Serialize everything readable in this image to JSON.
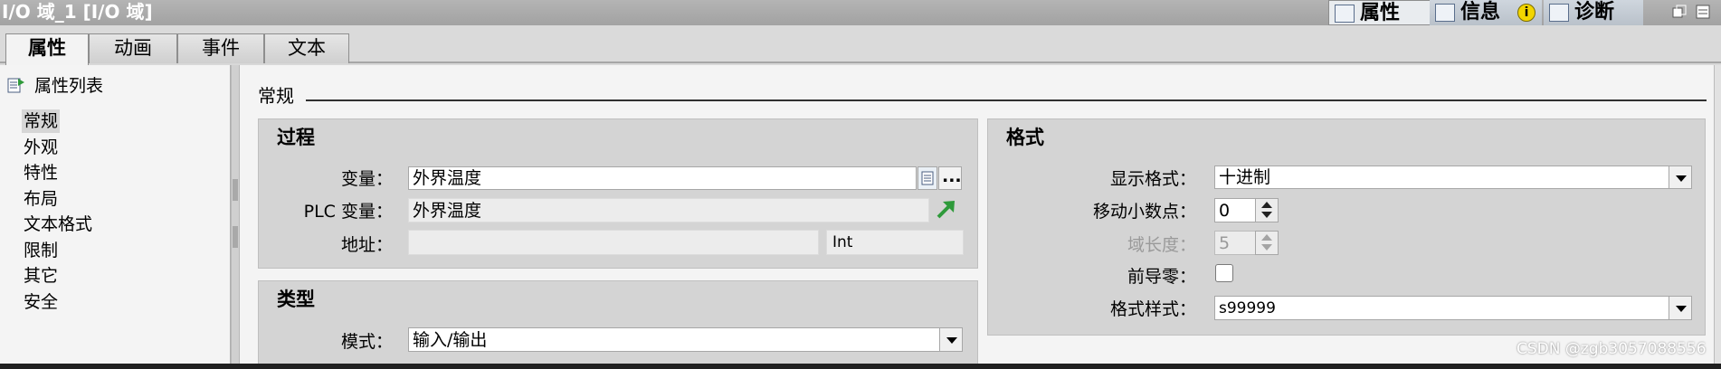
{
  "titlebar": {
    "title": "I/O 域_1 [I/O 域]",
    "tabs": [
      {
        "label": "属性",
        "icon": "properties-icon"
      },
      {
        "label": "信息",
        "icon": "info-icon"
      },
      {
        "label": "诊断",
        "icon": "diagnostics-icon"
      }
    ],
    "info_badge": "i"
  },
  "editor_tabs": [
    "属性",
    "动画",
    "事件",
    "文本"
  ],
  "tree": {
    "header": "属性列表",
    "items": [
      "常规",
      "外观",
      "特性",
      "布局",
      "文本格式",
      "限制",
      "其它",
      "安全"
    ],
    "selected_index": 0
  },
  "section": {
    "title": "常规"
  },
  "process": {
    "title": "过程",
    "variable_label": "变量：",
    "variable_value": "外界温度",
    "plc_variable_label": "PLC 变量：",
    "plc_variable_value": "外界温度",
    "address_label": "地址：",
    "address_value": "",
    "address_type": "Int",
    "browse_button": "..."
  },
  "type": {
    "title": "类型",
    "mode_label": "模式：",
    "mode_value": "输入/输出"
  },
  "format": {
    "title": "格式",
    "display_format_label": "显示格式：",
    "display_format_value": "十进制",
    "move_decimal_label": "移动小数点：",
    "move_decimal_value": "0",
    "field_length_label": "域长度：",
    "field_length_value": "5",
    "leading_zeros_label": "前导零：",
    "leading_zeros_checked": false,
    "format_pattern_label": "格式样式：",
    "format_pattern_value": "s99999"
  },
  "watermark": "CSDN @zgb3057088556",
  "colors": {
    "link_arrow": "#2e9a3a",
    "info_badge": "#f2d500"
  }
}
